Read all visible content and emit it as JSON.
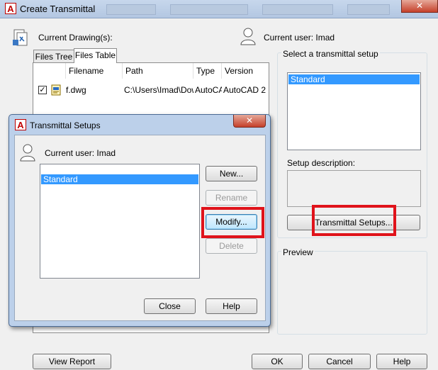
{
  "window": {
    "title": "Create Transmittal",
    "close_glyph": "✕",
    "app_glyph": "A"
  },
  "main": {
    "current_drawings_label": "Current Drawing(s):",
    "current_user_label": "Current user: Imad",
    "tabs": [
      {
        "label": "Files Tree"
      },
      {
        "label": "Files Table"
      }
    ],
    "files_table": {
      "columns": [
        "Filename",
        "Path",
        "Type",
        "Version"
      ],
      "rows": [
        {
          "filename": "f.dwg",
          "path": "C:\\Users\\Imad\\Dow",
          "type": "AutoCA",
          "version": "AutoCAD 2"
        }
      ]
    },
    "setup_group_label": "Select a transmittal setup",
    "setups": [
      "Standard"
    ],
    "setup_description_label": "Setup description:",
    "transmittal_setups_button": "Transmittal Setups...",
    "preview_label": "Preview",
    "view_report_button": "View Report",
    "ok_button": "OK",
    "cancel_button": "Cancel",
    "help_button": "Help"
  },
  "dialog": {
    "title": "Transmittal Setups",
    "current_user_label": "Current user: Imad",
    "setups": [
      "Standard"
    ],
    "new_button": "New...",
    "rename_button": "Rename",
    "modify_button": "Modify...",
    "delete_button": "Delete",
    "close_button": "Close",
    "help_button": "Help"
  },
  "colors": {
    "selection": "#3399ff",
    "annotation_highlight": "#e0131b",
    "titlebar": "#bcd0ea"
  }
}
